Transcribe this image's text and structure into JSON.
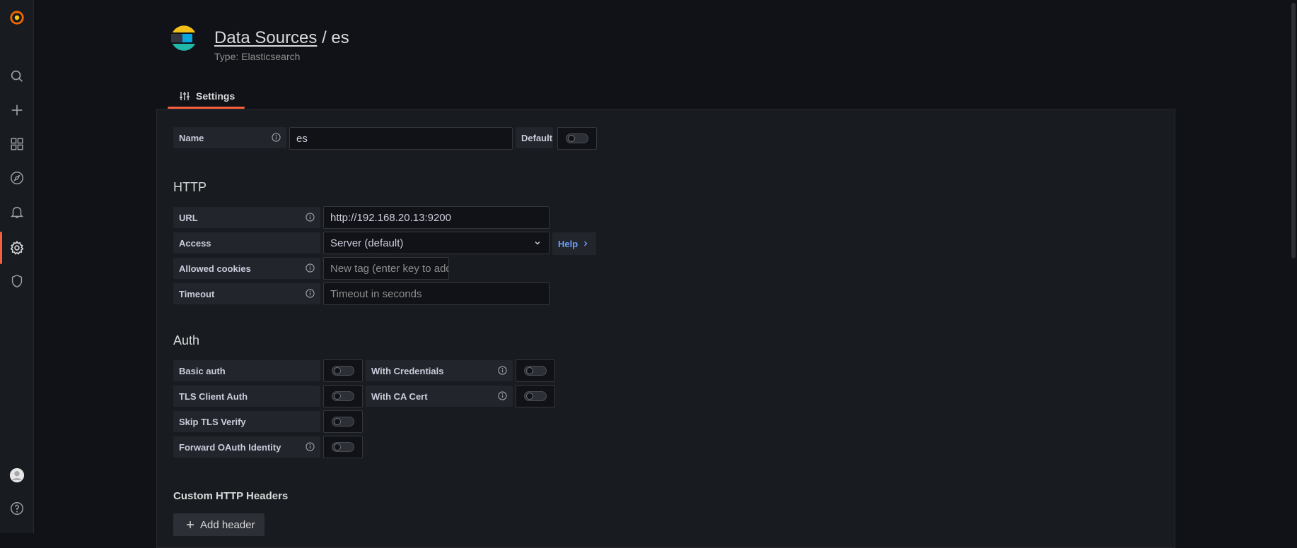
{
  "nav": {
    "icons": [
      "grafana-logo-icon",
      "search-icon",
      "plus-icon",
      "dashboards-icon",
      "explore-icon",
      "alerting-bell-icon",
      "configuration-gear-icon",
      "server-admin-shield-icon",
      "user-avatar-icon",
      "help-icon"
    ],
    "active": "configuration-gear-icon",
    "accent": "#f55f3e"
  },
  "header": {
    "breadcrumb_link": "Data Sources",
    "separator": " / ",
    "name": "es",
    "subtitle": "Type: Elasticsearch"
  },
  "tabs": [
    {
      "label": "Settings",
      "icon": "sliders-icon",
      "active": true
    }
  ],
  "form": {
    "name_label": "Name",
    "name_value": "es",
    "default_label": "Default",
    "default_enabled": false
  },
  "http": {
    "title": "HTTP",
    "url_label": "URL",
    "url_value": "http://192.168.20.13:9200",
    "access_label": "Access",
    "access_value": "Server (default)",
    "help_label": "Help",
    "cookies_label": "Allowed cookies",
    "cookies_placeholder": "New tag (enter key to add",
    "timeout_label": "Timeout",
    "timeout_placeholder": "Timeout in seconds"
  },
  "auth": {
    "title": "Auth",
    "basic_auth": "Basic auth",
    "with_credentials": "With Credentials",
    "tls_client_auth": "TLS Client Auth",
    "with_ca_cert": "With CA Cert",
    "skip_tls_verify": "Skip TLS Verify",
    "forward_oauth": "Forward OAuth Identity"
  },
  "custom_headers": {
    "title": "Custom HTTP Headers",
    "add_label": "Add header"
  }
}
